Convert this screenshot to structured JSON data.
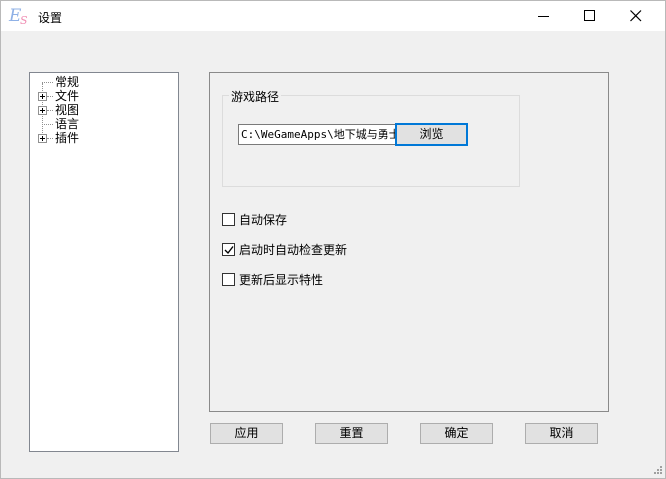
{
  "window": {
    "title": "设置",
    "icon_letters": {
      "primary": "E",
      "secondary": "S"
    },
    "controls": [
      "minimize-icon",
      "maximize-icon",
      "close-icon"
    ]
  },
  "tree": {
    "items": [
      {
        "label": "常规",
        "expandable": false
      },
      {
        "label": "文件",
        "expandable": true
      },
      {
        "label": "视图",
        "expandable": true
      },
      {
        "label": "语言",
        "expandable": false
      },
      {
        "label": "插件",
        "expandable": true
      }
    ]
  },
  "general": {
    "group_label": "游戏路径",
    "path_value": "C:\\WeGameApps\\地下城与勇士",
    "browse_label": "浏览",
    "options": [
      {
        "label": "自动保存",
        "checked": false
      },
      {
        "label": "启动时自动检查更新",
        "checked": true
      },
      {
        "label": "更新后显示特性",
        "checked": false
      }
    ]
  },
  "buttons": {
    "apply": "应用",
    "reset": "重置",
    "ok": "确定",
    "cancel": "取消"
  },
  "colors": {
    "focus_border": "#0078d7",
    "window_bg": "#f0f0f0",
    "titlebar_bg": "#ffffff"
  }
}
